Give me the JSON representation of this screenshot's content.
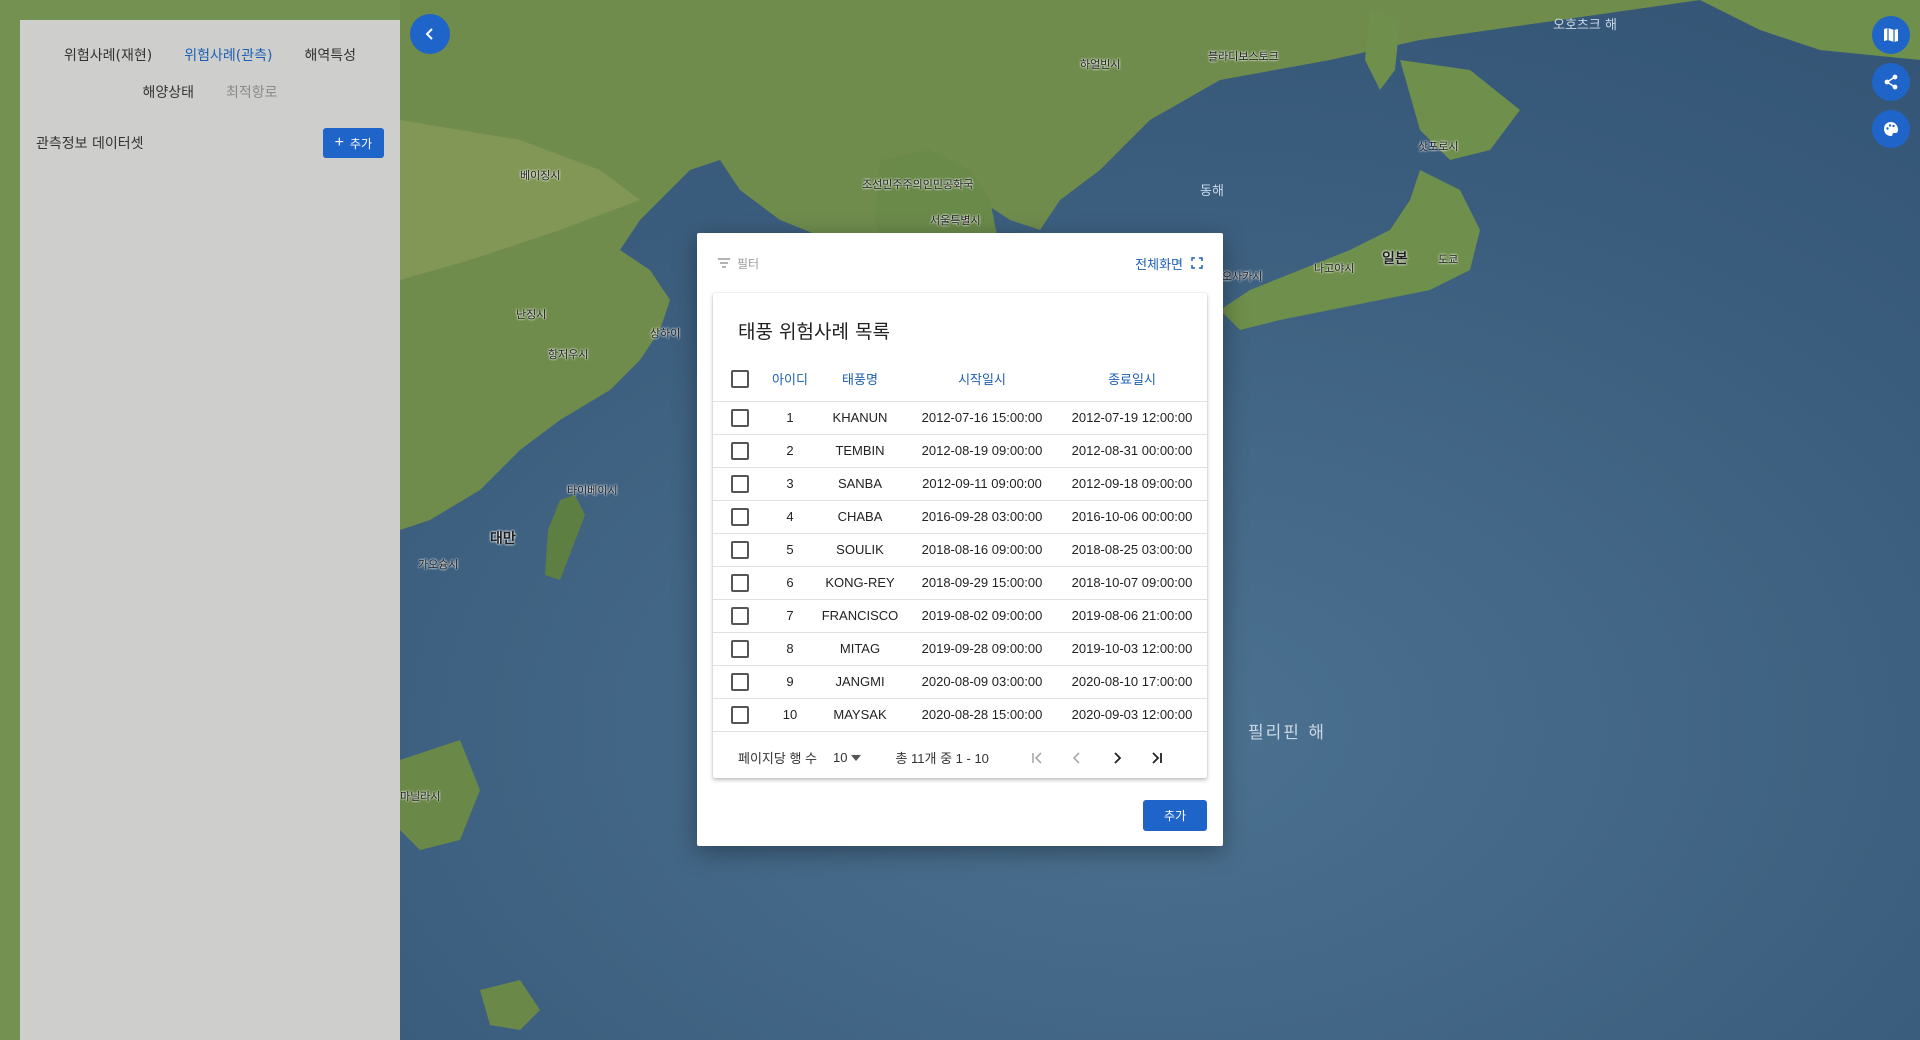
{
  "sidebar": {
    "tabs": [
      {
        "label": "위험사례(재현)",
        "state": "normal"
      },
      {
        "label": "위험사례(관측)",
        "state": "active"
      },
      {
        "label": "해역특성",
        "state": "normal"
      },
      {
        "label": "해양상태",
        "state": "normal"
      },
      {
        "label": "최적항로",
        "state": "disabled"
      }
    ],
    "section_title": "관측정보 데이터셋",
    "add_button": "추가"
  },
  "dialog": {
    "filter_label": "필터",
    "fullscreen_label": "전체화면",
    "title": "태풍 위험사례 목록",
    "columns": [
      "아이디",
      "태풍명",
      "시작일시",
      "종료일시"
    ],
    "rows": [
      {
        "id": "1",
        "name": "KHANUN",
        "start": "2012-07-16 15:00:00",
        "end": "2012-07-19 12:00:00"
      },
      {
        "id": "2",
        "name": "TEMBIN",
        "start": "2012-08-19 09:00:00",
        "end": "2012-08-31 00:00:00"
      },
      {
        "id": "3",
        "name": "SANBA",
        "start": "2012-09-11 09:00:00",
        "end": "2012-09-18 09:00:00"
      },
      {
        "id": "4",
        "name": "CHABA",
        "start": "2016-09-28 03:00:00",
        "end": "2016-10-06 00:00:00"
      },
      {
        "id": "5",
        "name": "SOULIK",
        "start": "2018-08-16 09:00:00",
        "end": "2018-08-25 03:00:00"
      },
      {
        "id": "6",
        "name": "KONG-REY",
        "start": "2018-09-29 15:00:00",
        "end": "2018-10-07 09:00:00"
      },
      {
        "id": "7",
        "name": "FRANCISCO",
        "start": "2019-08-02 09:00:00",
        "end": "2019-08-06 21:00:00"
      },
      {
        "id": "8",
        "name": "MITAG",
        "start": "2019-09-28 09:00:00",
        "end": "2019-10-03 12:00:00"
      },
      {
        "id": "9",
        "name": "JANGMI",
        "start": "2020-08-09 03:00:00",
        "end": "2020-08-10 17:00:00"
      },
      {
        "id": "10",
        "name": "MAYSAK",
        "start": "2020-08-28 15:00:00",
        "end": "2020-09-03 12:00:00"
      }
    ],
    "pager": {
      "rows_per_page_label": "페이지당 행 수",
      "rows_per_page_value": "10",
      "range_text": "총 11개 중 1 - 10"
    },
    "add_button": "추가"
  },
  "map": {
    "labels": [
      {
        "text": "필리핀 해",
        "kind": "big"
      },
      {
        "text": "동해",
        "kind": "sea"
      },
      {
        "text": "오호츠크 해",
        "kind": "sea"
      },
      {
        "text": "대만",
        "kind": "country"
      },
      {
        "text": "일본",
        "kind": "country"
      },
      {
        "text": "도쿄",
        "kind": "city"
      },
      {
        "text": "서울특별시",
        "kind": "city"
      },
      {
        "text": "조선민주주의인민공화국",
        "kind": "city"
      },
      {
        "text": "상하이",
        "kind": "city"
      },
      {
        "text": "타이베이시",
        "kind": "city"
      },
      {
        "text": "베이징시",
        "kind": "city"
      },
      {
        "text": "가오슝시",
        "kind": "city"
      },
      {
        "text": "오사카시",
        "kind": "city"
      },
      {
        "text": "나고야시",
        "kind": "city"
      },
      {
        "text": "삿포로시",
        "kind": "city"
      },
      {
        "text": "마닐라시",
        "kind": "city"
      },
      {
        "text": "항저우시",
        "kind": "city"
      },
      {
        "text": "난징시",
        "kind": "city"
      },
      {
        "text": "블라디보스토크",
        "kind": "city"
      },
      {
        "text": "하얼빈시",
        "kind": "city"
      }
    ]
  },
  "fab_icons": [
    "map-icon",
    "share-icon",
    "palette-icon"
  ],
  "colors": {
    "primary": "#1f64c8",
    "active_tab": "#1e5fb4",
    "sea": "#3d5f7e",
    "land": "#6b8a4a"
  }
}
